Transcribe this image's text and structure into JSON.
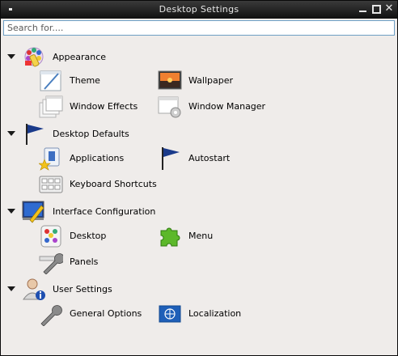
{
  "window": {
    "title": "Desktop Settings"
  },
  "search": {
    "placeholder": "Search for...."
  },
  "categories": [
    {
      "label": "Appearance",
      "icon": "appearance-palette-icon",
      "items": [
        {
          "label": "Theme",
          "icon": "theme-icon"
        },
        {
          "label": "Wallpaper",
          "icon": "wallpaper-icon"
        },
        {
          "label": "Window Effects",
          "icon": "window-effects-icon"
        },
        {
          "label": "Window Manager",
          "icon": "window-manager-icon"
        }
      ]
    },
    {
      "label": "Desktop Defaults",
      "icon": "flag-icon",
      "items": [
        {
          "label": "Applications",
          "icon": "applications-icon"
        },
        {
          "label": "Autostart",
          "icon": "autostart-flag-icon"
        },
        {
          "label": "Keyboard Shortcuts",
          "icon": "keyboard-icon"
        }
      ]
    },
    {
      "label": "Interface Configuration",
      "icon": "interface-configuration-icon",
      "items": [
        {
          "label": "Desktop",
          "icon": "desktop-icon"
        },
        {
          "label": "Menu",
          "icon": "menu-puzzle-icon"
        },
        {
          "label": "Panels",
          "icon": "panels-wrench-icon"
        }
      ]
    },
    {
      "label": "User Settings",
      "icon": "user-settings-icon",
      "items": [
        {
          "label": "General Options",
          "icon": "wrench-icon"
        },
        {
          "label": "Localization",
          "icon": "localization-flag-icon"
        }
      ]
    }
  ]
}
